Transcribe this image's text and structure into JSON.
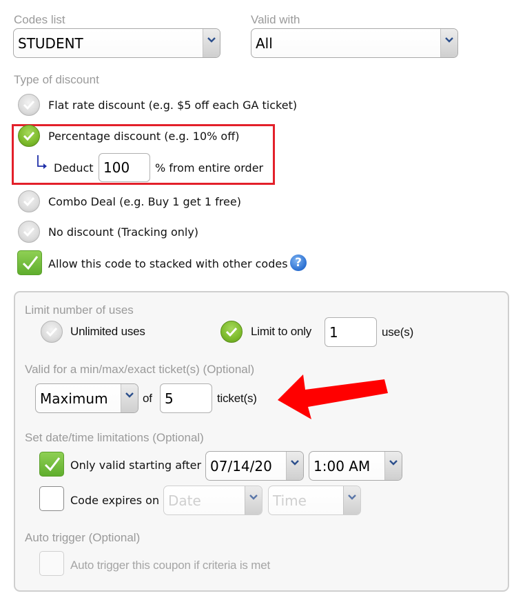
{
  "codes_list": {
    "label": "Codes list",
    "value": "STUDENT"
  },
  "valid_with": {
    "label": "Valid with",
    "value": "All"
  },
  "discount_type": {
    "label": "Type of discount",
    "options": [
      {
        "label": "Flat rate discount (e.g. $5 off each GA ticket)",
        "selected": false
      },
      {
        "label": "Percentage discount (e.g. 10% off)",
        "selected": true
      },
      {
        "label": "Combo Deal (e.g. Buy 1 get 1 free)",
        "selected": false
      },
      {
        "label": "No discount (Tracking only)",
        "selected": false
      }
    ],
    "deduct": {
      "prefix": "Deduct",
      "value": "100",
      "suffix": "% from entire order"
    },
    "stack": {
      "label": "Allow this code to stacked with other codes",
      "checked": true,
      "help": "?"
    }
  },
  "limit_uses": {
    "label": "Limit number of uses",
    "unlimited_label": "Unlimited uses",
    "limit_label": "Limit to only",
    "limit_value": "1",
    "limit_suffix": "use(s)",
    "selected": "limit"
  },
  "ticket_range": {
    "label": "Valid for a min/max/exact ticket(s) (Optional)",
    "mode": "Maximum",
    "of_label": "of",
    "value": "5",
    "suffix": "ticket(s)"
  },
  "date_limits": {
    "label": "Set date/time limitations (Optional)",
    "start": {
      "label": "Only valid starting after",
      "checked": true,
      "date": "07/14/20",
      "time": "1:00 AM"
    },
    "expire": {
      "label": "Code expires on",
      "checked": false,
      "date_placeholder": "Date",
      "time_placeholder": "Time"
    }
  },
  "auto_trigger": {
    "label": "Auto trigger (Optional)",
    "option_label": "Auto trigger this coupon if criteria is met",
    "checked": false
  },
  "annotations": {
    "highlight_color": "#e3202a",
    "arrow_color": "#ff0000"
  }
}
